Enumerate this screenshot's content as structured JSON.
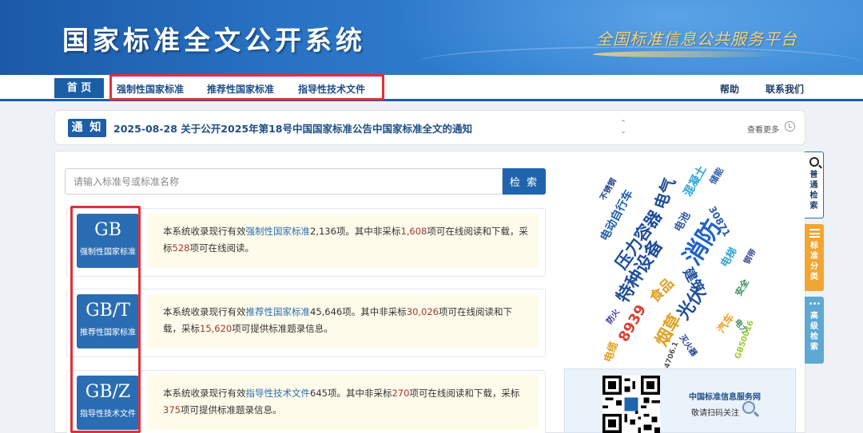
{
  "header": {
    "title": "国家标准全文公开系统",
    "slogan": "全国标准信息公共服务平台"
  },
  "nav": {
    "home": "首 页",
    "links": [
      "强制性国家标准",
      "推荐性国家标准",
      "指导性技术文件"
    ],
    "help": "帮助",
    "contact": "联系我们"
  },
  "notice": {
    "tag": "通 知",
    "text": "2025-08-28  关于公开2025年第18号中国国家标准公告中国家标准全文的通知",
    "more": "查看更多"
  },
  "search": {
    "placeholder": "请输入标准号或标准名称",
    "button": "检 索"
  },
  "standards": [
    {
      "code": "GB",
      "name": "强制性国家标准",
      "pre": "本系统收录现行有效",
      "type": "强制性国家标准",
      "total": "2,136",
      "mid1": "项。其中非采标",
      "online": "1,608",
      "mid2": "项可在线阅读和下载，采标",
      "adopted": "528",
      "tail": "项可在线阅读。"
    },
    {
      "code": "GB/T",
      "name": "推荐性国家标准",
      "pre": "本系统收录现行有效",
      "type": "推荐性国家标准",
      "total": "45,646",
      "mid1": "项。其中非采标",
      "online": "30,026",
      "mid2": "项可在线阅读和下载，采标",
      "adopted": "15,620",
      "tail": "项可提供标准题录信息。"
    },
    {
      "code": "GB/Z",
      "name": "指导性技术文件",
      "pre": "本系统收录现行有效",
      "type": "指导性技术文件",
      "total": "645",
      "mid1": "项。其中非采标",
      "online": "270",
      "mid2": "项可在线阅读和下载，采标",
      "adopted": "375",
      "tail": "项可提供标准题录信息。"
    }
  ],
  "word_cloud": [
    "不锈钢",
    "电动自行车",
    "电气",
    "混凝土",
    "储能",
    "压力容器",
    "电池",
    "30871",
    "消防",
    "特种设备",
    "电梯",
    "钢带",
    "食品",
    "建筑",
    "光伏",
    "安全",
    "防火",
    "8939",
    "烟草",
    "汽车",
    "电力",
    "电缆",
    "4706.1",
    "灭火器",
    "GB50016"
  ],
  "qr": {
    "title": "中国标准信息服务网",
    "subtitle": "敬请扫码关注"
  },
  "side_tabs": [
    "普通检索",
    "标准分类",
    "高级检索"
  ],
  "colors": {
    "primary": "#1f64ad",
    "accent_red": "#e0303a",
    "highlight_num": "#a33",
    "class_tab": "#f0a633",
    "adv_tab": "#5fa8d3"
  }
}
